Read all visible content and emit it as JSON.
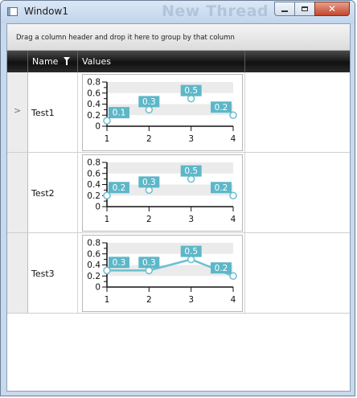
{
  "window": {
    "title": "Window1",
    "ghost_title": "New Thread"
  },
  "grid": {
    "group_panel_text": "Drag a column header and drop it here to group by that column",
    "columns": [
      {
        "label": "Name",
        "has_filter": true
      },
      {
        "label": "Values",
        "has_filter": false
      }
    ],
    "rows": [
      {
        "name": "Test1",
        "current": true
      },
      {
        "name": "Test2",
        "current": false
      },
      {
        "name": "Test3",
        "current": false
      }
    ]
  },
  "colors": {
    "series": "#6bbfd0",
    "label_bg": "#5db7c8",
    "band": "#ebebeb"
  },
  "chart_data": [
    {
      "type": "line",
      "categories": [
        1,
        2,
        3,
        4
      ],
      "values": [
        0.1,
        0.3,
        0.5,
        0.2
      ],
      "data_labels": [
        "0.1",
        "0.3",
        "0.5",
        "0.2"
      ],
      "line_shown": false,
      "yticks": [
        "0.8",
        "0.6",
        "0.4",
        "0.2",
        "0"
      ],
      "ylim": [
        0,
        0.8
      ]
    },
    {
      "type": "line",
      "categories": [
        1,
        2,
        3,
        4
      ],
      "values": [
        0.2,
        0.3,
        0.5,
        0.2
      ],
      "data_labels": [
        "0.2",
        "0.3",
        "0.5",
        "0.2"
      ],
      "line_shown": false,
      "yticks": [
        "0.8",
        "0.6",
        "0.4",
        "0.2",
        "0"
      ],
      "ylim": [
        0,
        0.8
      ]
    },
    {
      "type": "line",
      "categories": [
        1,
        2,
        3,
        4
      ],
      "values": [
        0.3,
        0.3,
        0.5,
        0.2
      ],
      "data_labels": [
        "0.3",
        "0.3",
        "0.5",
        "0.2"
      ],
      "line_shown": true,
      "yticks": [
        "0.8",
        "0.6",
        "0.4",
        "0.2",
        "0"
      ],
      "ylim": [
        0,
        0.8
      ]
    }
  ]
}
